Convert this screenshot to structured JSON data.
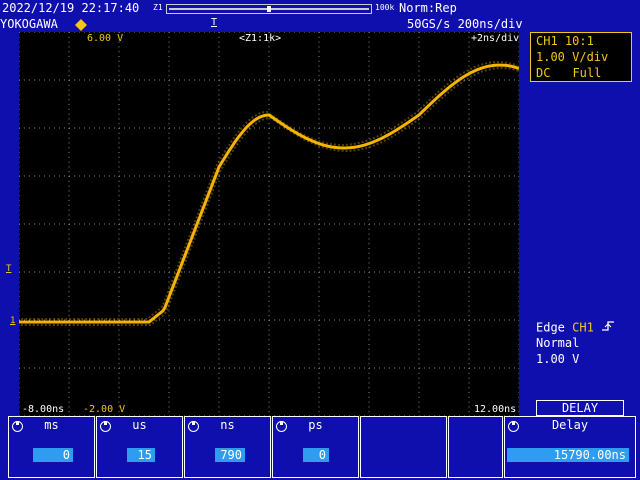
{
  "header": {
    "datetime": "2022/12/19 22:17:40",
    "zoom_left": "Z1",
    "zoom_right": "100k",
    "mode": "Norm:Rep",
    "brand": "YOKOGAWA",
    "trigger_pos_marker": "T",
    "sample_rate": "50GS/s 200ns/div"
  },
  "screen": {
    "v_top": "6.00 V",
    "zoom_label": "<Z1:1k>",
    "zoom_div": "+2ns/div",
    "v_bottom": "-2.00 V",
    "t_left": "-8.00ns",
    "t_right": "12.00ns",
    "trig_level_marker": "T",
    "ground_marker": "1",
    "trace_color": "#f5b400"
  },
  "ch1": {
    "line1": "CH1 10:1",
    "line2": "1.00 V/div",
    "coupling": "DC",
    "bandwidth": "Full"
  },
  "trigger": {
    "type": "Edge",
    "source": "CH1",
    "mode": "Normal",
    "level": "1.00 V"
  },
  "softkeys": {
    "ms_label": "ms",
    "ms_value": "0",
    "us_label": "us",
    "us_value": "15",
    "ns_label": "ns",
    "ns_value": "790",
    "ps_label": "ps",
    "ps_value": "0",
    "delay_title": "DELAY",
    "delay_label": "Delay",
    "delay_value": "15790.00ns"
  }
}
